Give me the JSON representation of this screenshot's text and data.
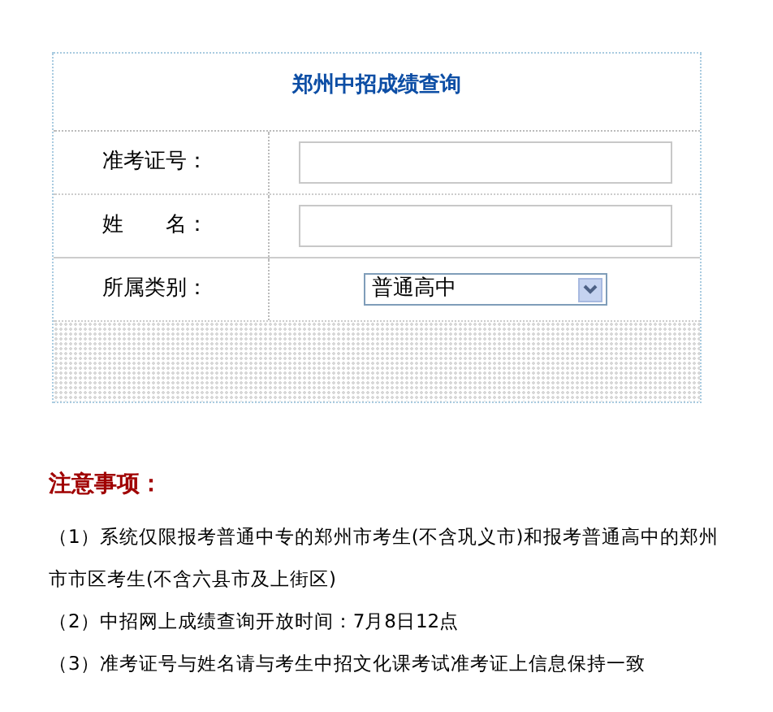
{
  "form": {
    "title": "郑州中招成绩查询",
    "fields": [
      {
        "kind": "input",
        "label": "准考证号："
      },
      {
        "kind": "input",
        "label": "姓　　名："
      },
      {
        "kind": "select",
        "label": "所属类别：",
        "value": "普通高中"
      }
    ]
  },
  "notes": {
    "heading": "注意事项：",
    "items": [
      "（1）系统仅限报考普通中专的郑州市考生(不含巩义市)和报考普通高中的郑州市市区考生(不含六县市及上街区)",
      "（2）中招网上成绩查询开放时间：7月8日12点",
      "（3）准考证号与姓名请与考生中招文化课考试准考证上信息保持一致"
    ]
  }
}
